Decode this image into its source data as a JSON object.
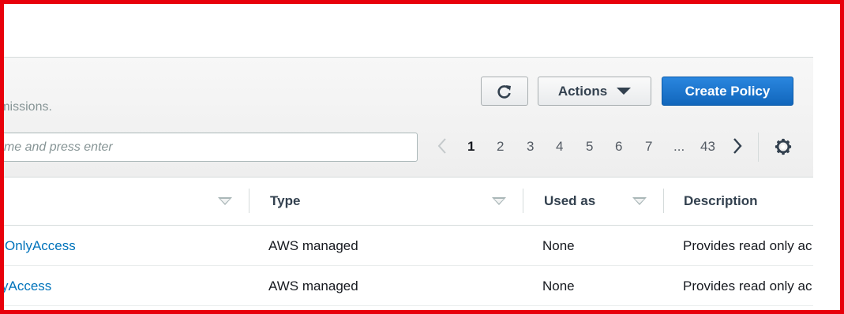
{
  "toolbar": {
    "description": "ermissions.",
    "actions_label": "Actions",
    "create_label": "Create Policy"
  },
  "search": {
    "placeholder": "ame and press enter"
  },
  "pagination": {
    "pages": [
      "1",
      "2",
      "3",
      "4",
      "5",
      "6",
      "7",
      "...",
      "43"
    ],
    "current": "1"
  },
  "table": {
    "columns": [
      "Type",
      "Used as",
      "Description"
    ],
    "rows": [
      {
        "name": "OnlyAccess",
        "type": "AWS managed",
        "used_as": "None",
        "description": "Provides read only ac"
      },
      {
        "name": "yAccess",
        "type": "AWS managed",
        "used_as": "None",
        "description": "Provides read only ac"
      }
    ]
  },
  "colors": {
    "primary": "#1166bb",
    "link": "#0073bb",
    "frame": "#e8000b"
  },
  "icons": [
    "refresh-icon",
    "caret-down-icon",
    "chevron-left-icon",
    "chevron-right-icon",
    "gear-icon",
    "sort-icon"
  ]
}
